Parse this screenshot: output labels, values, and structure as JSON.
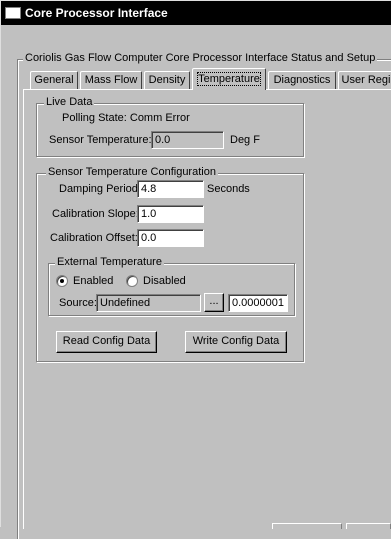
{
  "window": {
    "title": "Core Processor Interface"
  },
  "outer_group": {
    "label": "Coriolis Gas Flow Computer Core Processor Interface Status and Setup"
  },
  "tabs": [
    {
      "label": "General",
      "active": false
    },
    {
      "label": "Mass Flow",
      "active": false
    },
    {
      "label": "Density",
      "active": false
    },
    {
      "label": "Temperature",
      "active": true
    },
    {
      "label": "Diagnostics",
      "active": false
    },
    {
      "label": "User Regi",
      "active": false
    }
  ],
  "live_data": {
    "label": "Live Data",
    "polling_state": "Polling State: Comm Error",
    "sensor_temp_label": "Sensor Temperature:",
    "sensor_temp_value": "0.0",
    "sensor_temp_unit": "Deg F"
  },
  "config": {
    "label": "Sensor Temperature Configuration",
    "damping_label": "Damping Period:",
    "damping_value": "4.8",
    "damping_unit": "Seconds",
    "slope_label": "Calibration Slope:",
    "slope_value": "1.0",
    "offset_label": "Calibration Offset:",
    "offset_value": "0.0"
  },
  "external": {
    "label": "External Temperature",
    "enabled_label": "Enabled",
    "disabled_label": "Disabled",
    "selected": "enabled",
    "source_label": "Source:",
    "source_value": "Undefined",
    "browse_label": "...",
    "value": "0.0000001"
  },
  "buttons": {
    "read_label": "Read Config Data",
    "write_label": "Write Config Data"
  },
  "colors": {
    "face": "#c0c0c0",
    "title_bar": "#000000",
    "title_text": "#ffffff"
  }
}
